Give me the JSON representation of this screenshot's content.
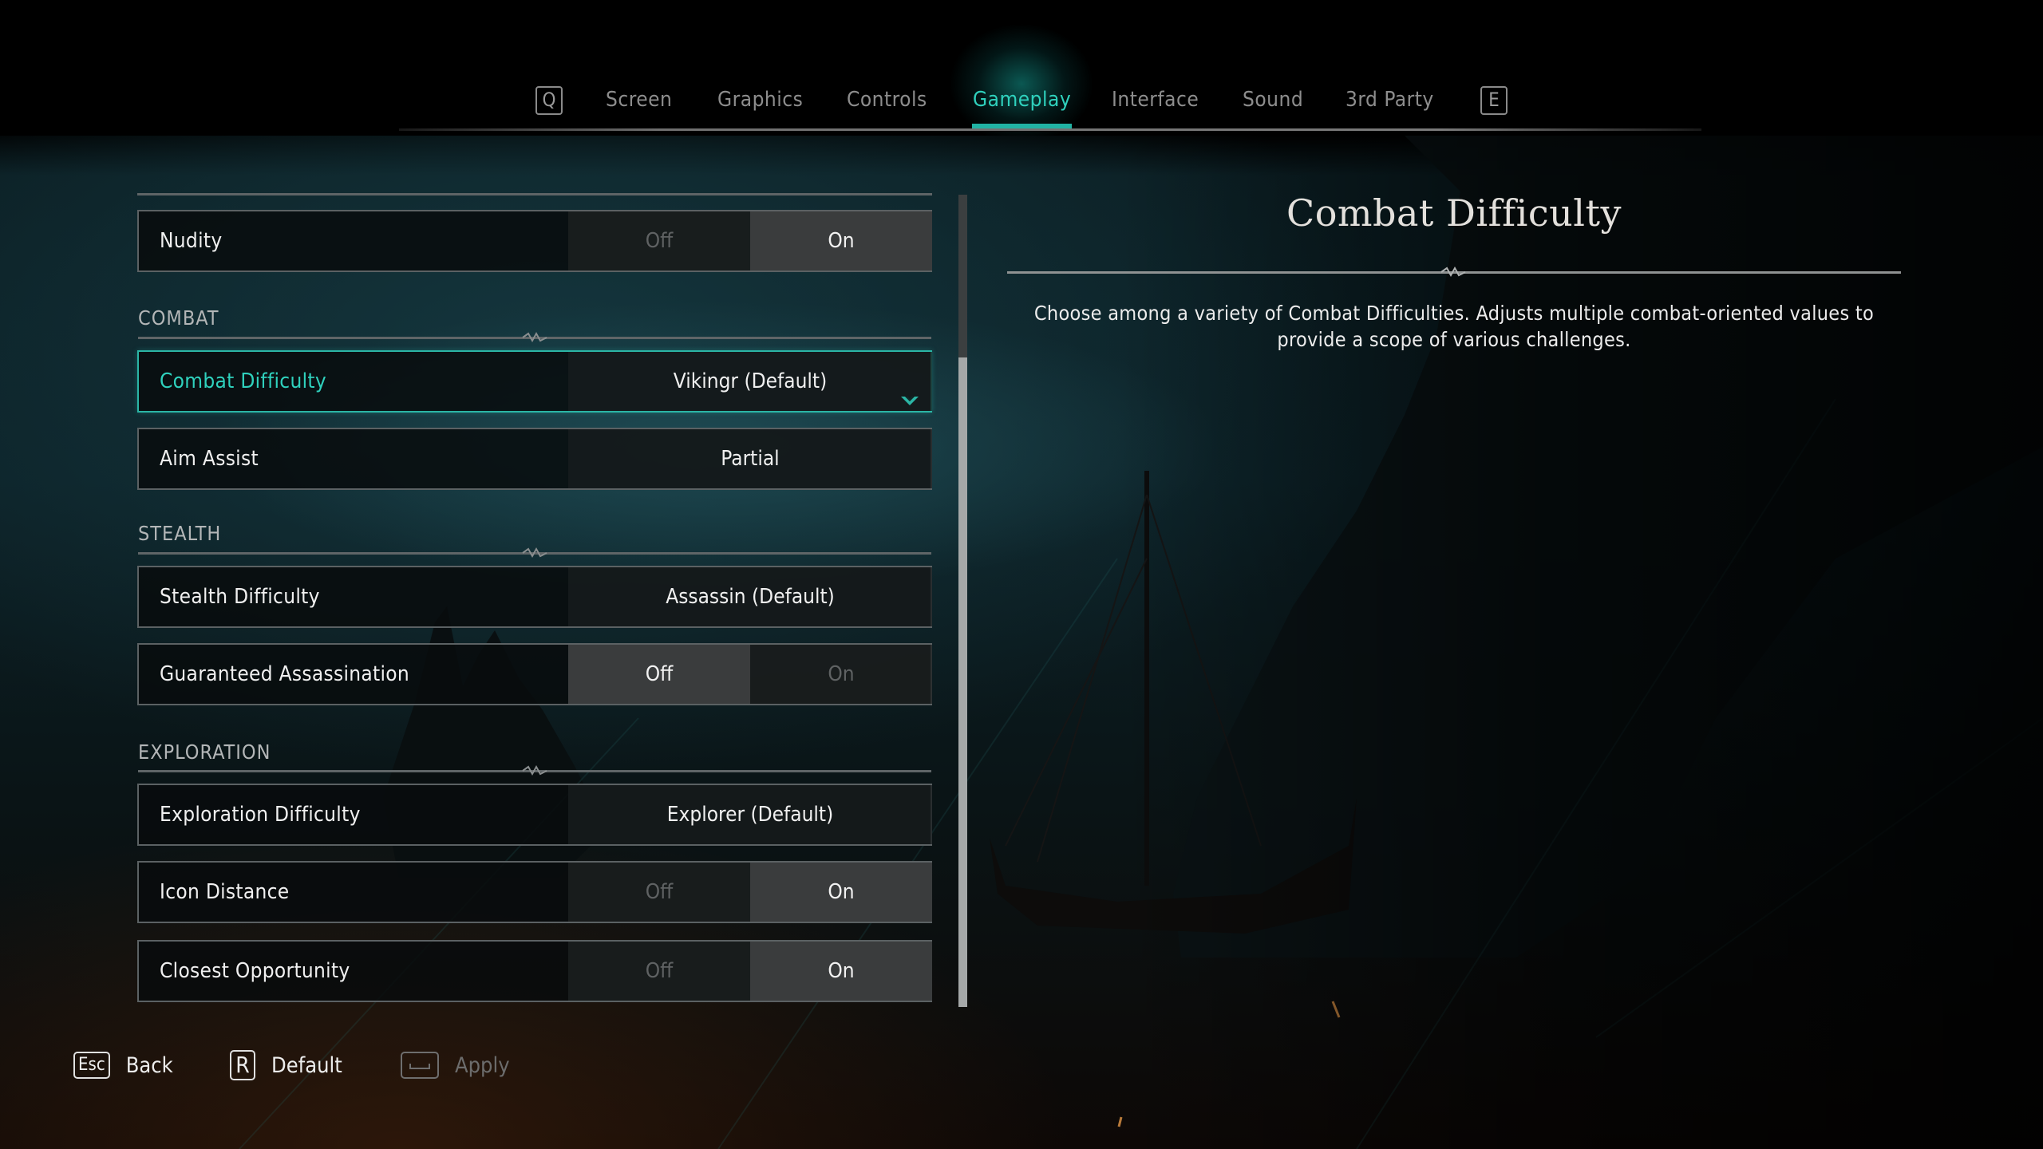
{
  "tabs": {
    "prev_key": "Q",
    "next_key": "E",
    "items": [
      {
        "label": "Screen",
        "active": false
      },
      {
        "label": "Graphics",
        "active": false
      },
      {
        "label": "Controls",
        "active": false
      },
      {
        "label": "Gameplay",
        "active": true
      },
      {
        "label": "Interface",
        "active": false
      },
      {
        "label": "Sound",
        "active": false
      },
      {
        "label": "3rd Party",
        "active": false
      }
    ]
  },
  "settings": {
    "nudity": {
      "label": "Nudity",
      "off": "Off",
      "on": "On",
      "selected": "On"
    },
    "sections": {
      "combat": "COMBAT",
      "stealth": "STEALTH",
      "exploration": "EXPLORATION"
    },
    "combat_difficulty": {
      "label": "Combat Difficulty",
      "value": "Vikingr (Default)",
      "focused": true
    },
    "aim_assist": {
      "label": "Aim Assist",
      "value": "Partial"
    },
    "stealth_difficulty": {
      "label": "Stealth Difficulty",
      "value": "Assassin (Default)"
    },
    "guaranteed_assassination": {
      "label": "Guaranteed Assassination",
      "off": "Off",
      "on": "On",
      "selected": "Off"
    },
    "exploration_difficulty": {
      "label": "Exploration Difficulty",
      "value": "Explorer (Default)"
    },
    "icon_distance": {
      "label": "Icon Distance",
      "off": "Off",
      "on": "On",
      "selected": "On"
    },
    "closest_opportunity": {
      "label": "Closest Opportunity",
      "off": "Off",
      "on": "On",
      "selected": "On"
    }
  },
  "scrollbar": {
    "thumb_start_fraction": 0.2,
    "thumb_end_fraction": 1.0
  },
  "detail": {
    "title": "Combat Difficulty",
    "description_line1": "Choose among a variety of Combat Difficulties. Adjusts multiple combat-oriented values to",
    "description_line2": "provide a scope of various challenges."
  },
  "footer": {
    "back": {
      "key": "Esc",
      "label": "Back"
    },
    "default": {
      "key": "R",
      "label": "Default"
    },
    "apply": {
      "key": "",
      "label": "Apply",
      "enabled": false
    }
  },
  "colors": {
    "accent": "#2fd1bd",
    "row_border": "#5b6163",
    "selected_option_bg": "#3a3c3d"
  }
}
